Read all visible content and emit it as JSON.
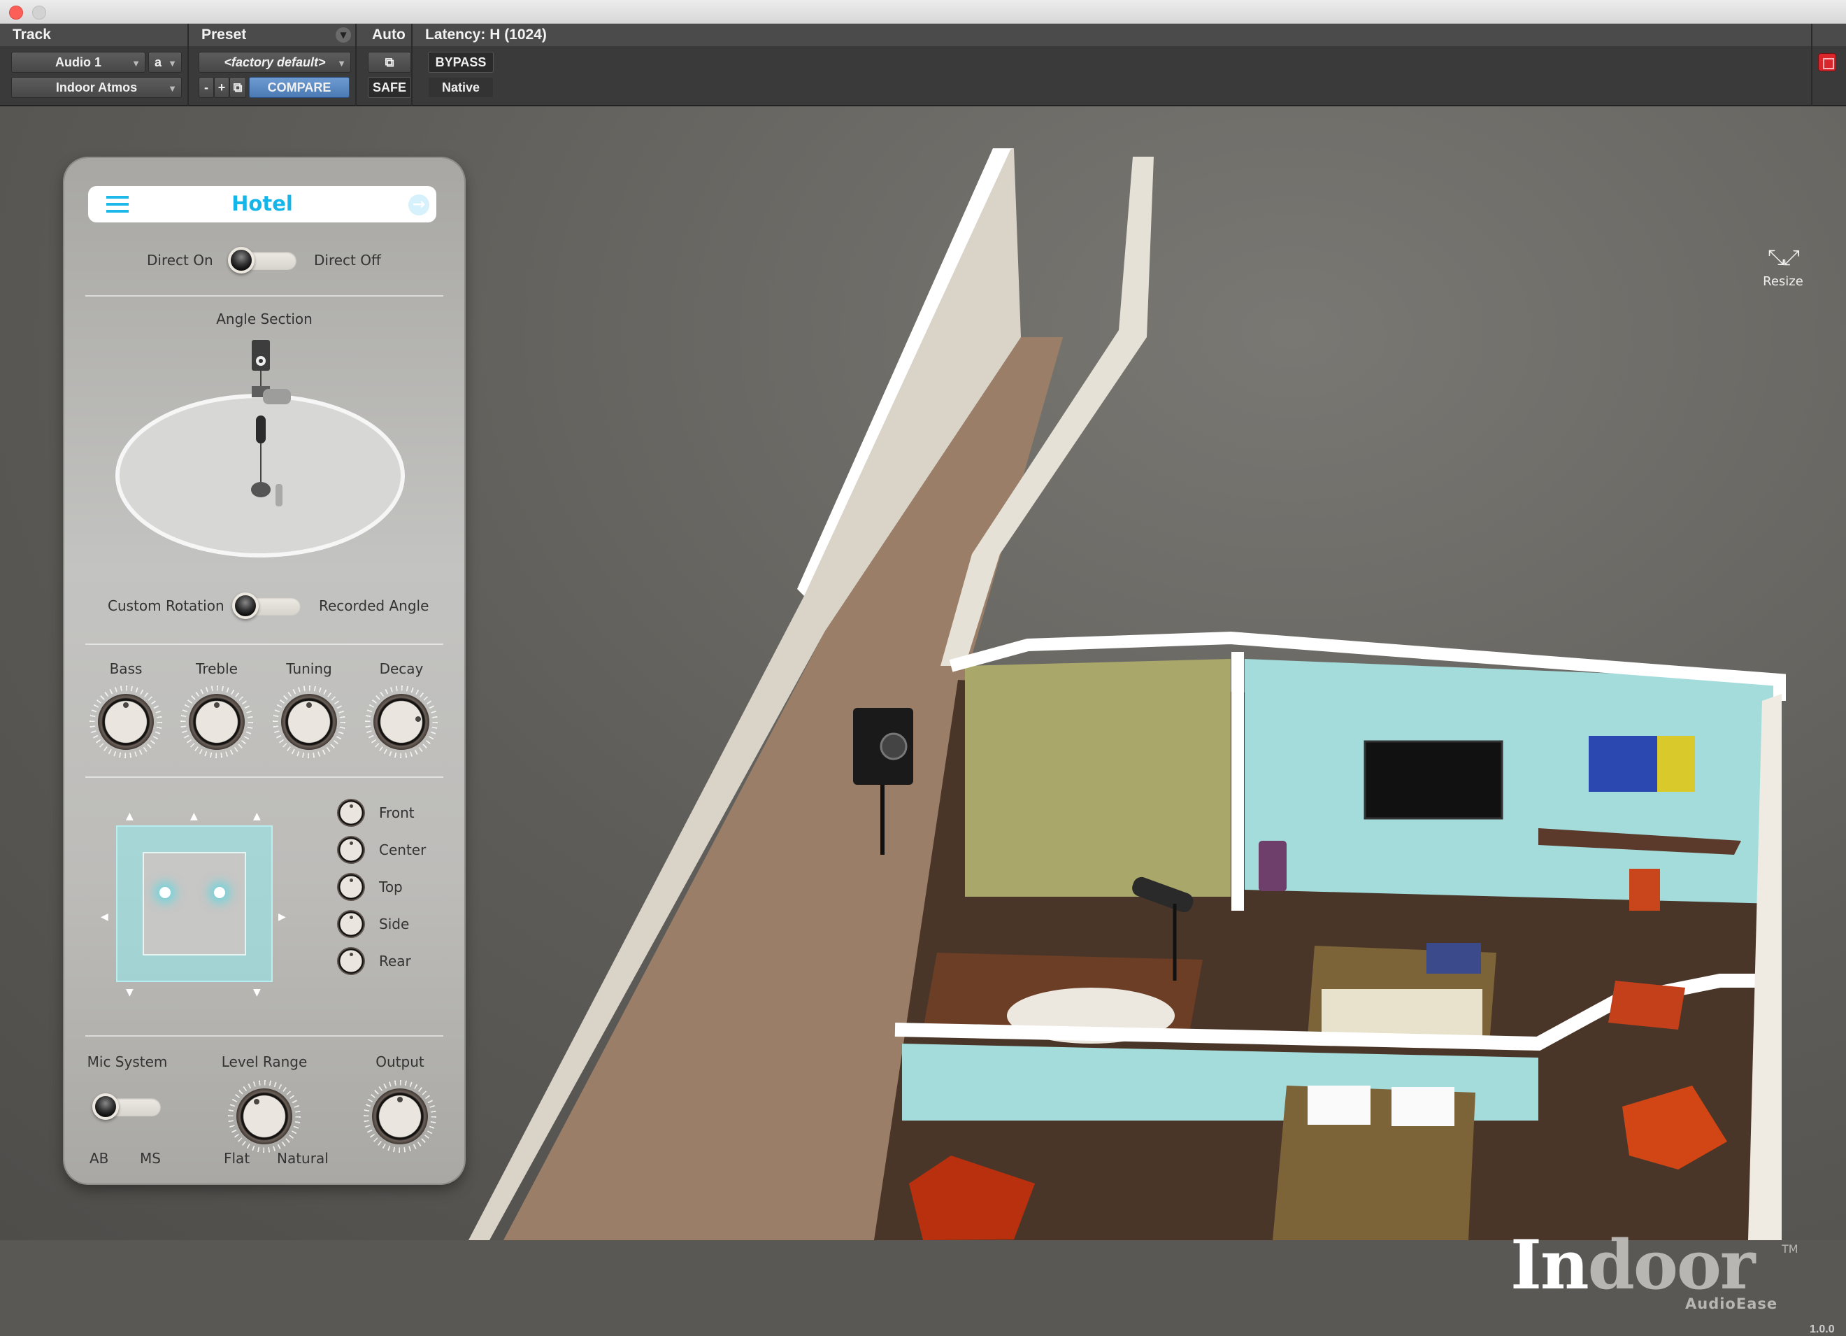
{
  "window": {
    "controls": [
      "close",
      "minimize"
    ]
  },
  "host": {
    "track_header": "Track",
    "preset_header": "Preset",
    "auto_header": "Auto",
    "latency_header": "Latency: H (1024)",
    "track_name": "Audio 1",
    "channel": "a",
    "plugin_name": "Indoor Atmos",
    "preset_value": "<factory default>",
    "preset_minus": "-",
    "preset_plus": "+",
    "compare_label": "COMPARE",
    "safe_label": "SAFE",
    "bypass_label": "BYPASS",
    "native_label": "Native"
  },
  "panel": {
    "room_title": "Hotel",
    "direct": {
      "left_label": "Direct On",
      "right_label": "Direct Off",
      "state": "Direct On"
    },
    "angle_section_label": "Angle Section",
    "rotation": {
      "left_label": "Custom Rotation",
      "right_label": "Recorded Angle",
      "state": "Custom Rotation"
    },
    "tone_knobs": [
      {
        "label": "Bass",
        "value_pct": 50
      },
      {
        "label": "Treble",
        "value_pct": 50
      },
      {
        "label": "Tuning",
        "value_pct": 50
      },
      {
        "label": "Decay",
        "value_pct": 80
      }
    ],
    "speaker_levels": [
      {
        "label": "Front",
        "value_pct": 50
      },
      {
        "label": "Center",
        "value_pct": 50
      },
      {
        "label": "Top",
        "value_pct": 50
      },
      {
        "label": "Side",
        "value_pct": 50
      },
      {
        "label": "Rear",
        "value_pct": 50
      }
    ],
    "mic_system": {
      "label": "Mic System",
      "left": "AB",
      "right": "MS",
      "state": "AB"
    },
    "level_range": {
      "label": "Level Range",
      "left": "Flat",
      "right": "Natural",
      "value_pct": 40
    },
    "output": {
      "label": "Output",
      "value_pct": 50
    }
  },
  "resize": {
    "label": "Resize",
    "icon": "collapse-arrows-icon"
  },
  "logo": {
    "part1": "In",
    "part2": "door",
    "tm": "TM",
    "brand": "AudioEase"
  },
  "version": "1.0.0",
  "colors": {
    "accent": "#14b5e9",
    "compare": "#5b89c4",
    "bypass_indicator": "#d9262b"
  }
}
